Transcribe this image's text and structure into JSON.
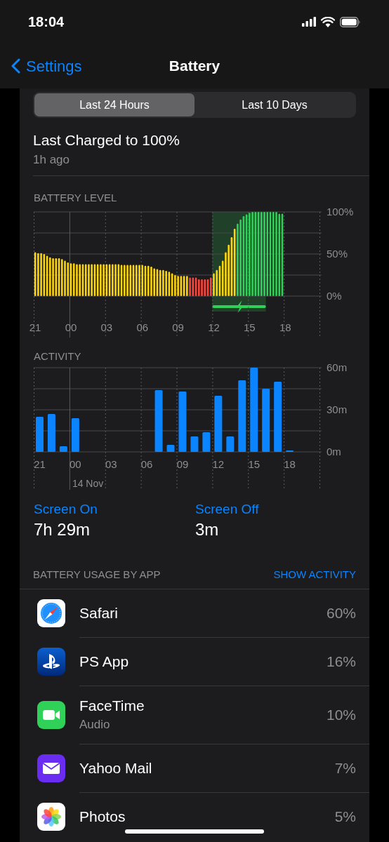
{
  "status_bar": {
    "time": "18:04"
  },
  "nav": {
    "back": "Settings",
    "title": "Battery"
  },
  "tabs": [
    {
      "label": "Last 24 Hours",
      "selected": true
    },
    {
      "label": "Last 10 Days",
      "selected": false
    }
  ],
  "last_charged": {
    "title": "Last Charged to 100%",
    "time": "1h ago"
  },
  "battery_level": {
    "title": "BATTERY LEVEL",
    "chart_data": {
      "type": "bar",
      "stacked": true,
      "ylim": [
        0,
        100
      ],
      "categories": [
        "21",
        null,
        null,
        null,
        null,
        null,
        null,
        null,
        null,
        null,
        null,
        null,
        "00",
        null,
        null,
        null,
        null,
        null,
        null,
        null,
        null,
        null,
        null,
        null,
        "03",
        null,
        null,
        null,
        null,
        null,
        null,
        null,
        null,
        null,
        null,
        null,
        "06",
        null,
        null,
        null,
        null,
        null,
        null,
        null,
        null,
        null,
        null,
        null,
        "09",
        null,
        null,
        null,
        null,
        null,
        null,
        null,
        null,
        null,
        null,
        null,
        "12",
        null,
        null,
        null,
        null,
        null,
        null,
        null,
        null,
        null,
        null,
        null,
        "15",
        null,
        null,
        null,
        null,
        null,
        null,
        null,
        null,
        null,
        null,
        null,
        "18",
        null,
        null,
        null,
        null,
        null,
        null,
        null,
        null,
        null,
        null,
        null
      ],
      "yticks": [
        {
          "value": 0,
          "label": "0%"
        },
        {
          "value": 50,
          "label": "50%"
        },
        {
          "value": 100,
          "label": "100%"
        }
      ],
      "series": [
        {
          "color": "#ffd60a",
          "values": [
            52,
            51,
            51,
            50,
            48,
            46,
            45,
            45,
            45,
            44,
            42,
            40,
            39,
            39,
            38,
            38,
            38,
            38,
            38,
            38,
            38,
            38,
            38,
            38,
            38,
            38,
            38,
            38,
            38,
            37,
            37,
            37,
            37,
            37,
            37,
            37,
            37,
            36,
            36,
            35,
            33,
            32,
            31,
            31,
            30,
            29,
            27,
            25,
            24,
            24,
            24,
            24,
            null,
            null,
            null,
            null,
            null,
            null,
            null,
            null,
            27,
            31,
            36,
            42,
            52,
            61,
            70,
            80,
            null,
            null,
            null,
            null,
            null,
            null,
            null,
            null,
            null,
            null,
            null,
            null,
            null,
            null,
            null,
            null,
            null,
            null,
            null,
            null,
            null,
            null,
            null,
            null,
            null,
            null,
            null,
            null
          ]
        },
        {
          "color": "#ff453a",
          "values": [
            null,
            null,
            null,
            null,
            null,
            null,
            null,
            null,
            null,
            null,
            null,
            null,
            null,
            null,
            null,
            null,
            null,
            null,
            null,
            null,
            null,
            null,
            null,
            null,
            null,
            null,
            null,
            null,
            null,
            null,
            null,
            null,
            null,
            null,
            null,
            null,
            null,
            null,
            null,
            null,
            null,
            null,
            null,
            null,
            null,
            null,
            null,
            null,
            null,
            null,
            null,
            null,
            22,
            22,
            22,
            20,
            20,
            20,
            20,
            22,
            null,
            null,
            null,
            null,
            null,
            null,
            null,
            null,
            null,
            null,
            null,
            null,
            null,
            null,
            null,
            null,
            null,
            null,
            null,
            null,
            null,
            null,
            null,
            null,
            null,
            null,
            null,
            null,
            null,
            null,
            null,
            null,
            null,
            null,
            null,
            null
          ]
        },
        {
          "color": "#30d158",
          "values": [
            null,
            null,
            null,
            null,
            null,
            null,
            null,
            null,
            null,
            null,
            null,
            null,
            null,
            null,
            null,
            null,
            null,
            null,
            null,
            null,
            null,
            null,
            null,
            null,
            null,
            null,
            null,
            null,
            null,
            null,
            null,
            null,
            null,
            null,
            null,
            null,
            null,
            null,
            null,
            null,
            null,
            null,
            null,
            null,
            null,
            null,
            null,
            null,
            null,
            null,
            null,
            null,
            null,
            null,
            null,
            null,
            null,
            null,
            null,
            null,
            null,
            null,
            null,
            null,
            null,
            null,
            null,
            null,
            86,
            91,
            95,
            97,
            99,
            100,
            100,
            100,
            100,
            100,
            100,
            100,
            100,
            100,
            98,
            98,
            null,
            null,
            null,
            null,
            null,
            null,
            null,
            null,
            null,
            null,
            null,
            null
          ]
        }
      ]
    }
  },
  "activity": {
    "title": "ACTIVITY",
    "chart_data": {
      "type": "bar",
      "ylim": [
        0,
        60
      ],
      "categories": [
        "21",
        null,
        null,
        "00",
        null,
        null,
        "03",
        null,
        null,
        "06",
        null,
        null,
        "09",
        null,
        null,
        "12",
        null,
        null,
        "15",
        null,
        null,
        "18",
        null,
        null
      ],
      "yticks": [
        {
          "value": 0,
          "label": "0m"
        },
        {
          "value": 30,
          "label": "30m"
        },
        {
          "value": 60,
          "label": "60m"
        }
      ],
      "series": [
        {
          "color": "#0a84ff",
          "values": [
            25,
            27,
            4,
            24,
            null,
            null,
            null,
            null,
            null,
            null,
            44,
            5,
            43,
            11,
            14,
            40,
            11,
            51,
            60,
            45,
            50,
            1,
            null,
            null
          ]
        }
      ],
      "annotations": [
        "14 Nov"
      ]
    }
  },
  "screen_time": [
    {
      "label": "Screen On",
      "value": "7h 29m"
    },
    {
      "label": "Screen Off",
      "value": "3m"
    }
  ],
  "usage": {
    "title": "BATTERY USAGE BY APP",
    "action": "SHOW ACTIVITY",
    "apps": [
      {
        "kind": "safari",
        "name": "Safari",
        "percent": "60%"
      },
      {
        "kind": "playstation",
        "name": "PS App",
        "percent": "16%"
      },
      {
        "kind": "facetime",
        "name": "FaceTime",
        "detail": "Audio",
        "percent": "10%"
      },
      {
        "kind": "mail",
        "name": "Yahoo Mail",
        "percent": "7%"
      },
      {
        "kind": "photos",
        "name": "Photos",
        "percent": "5%"
      }
    ]
  }
}
